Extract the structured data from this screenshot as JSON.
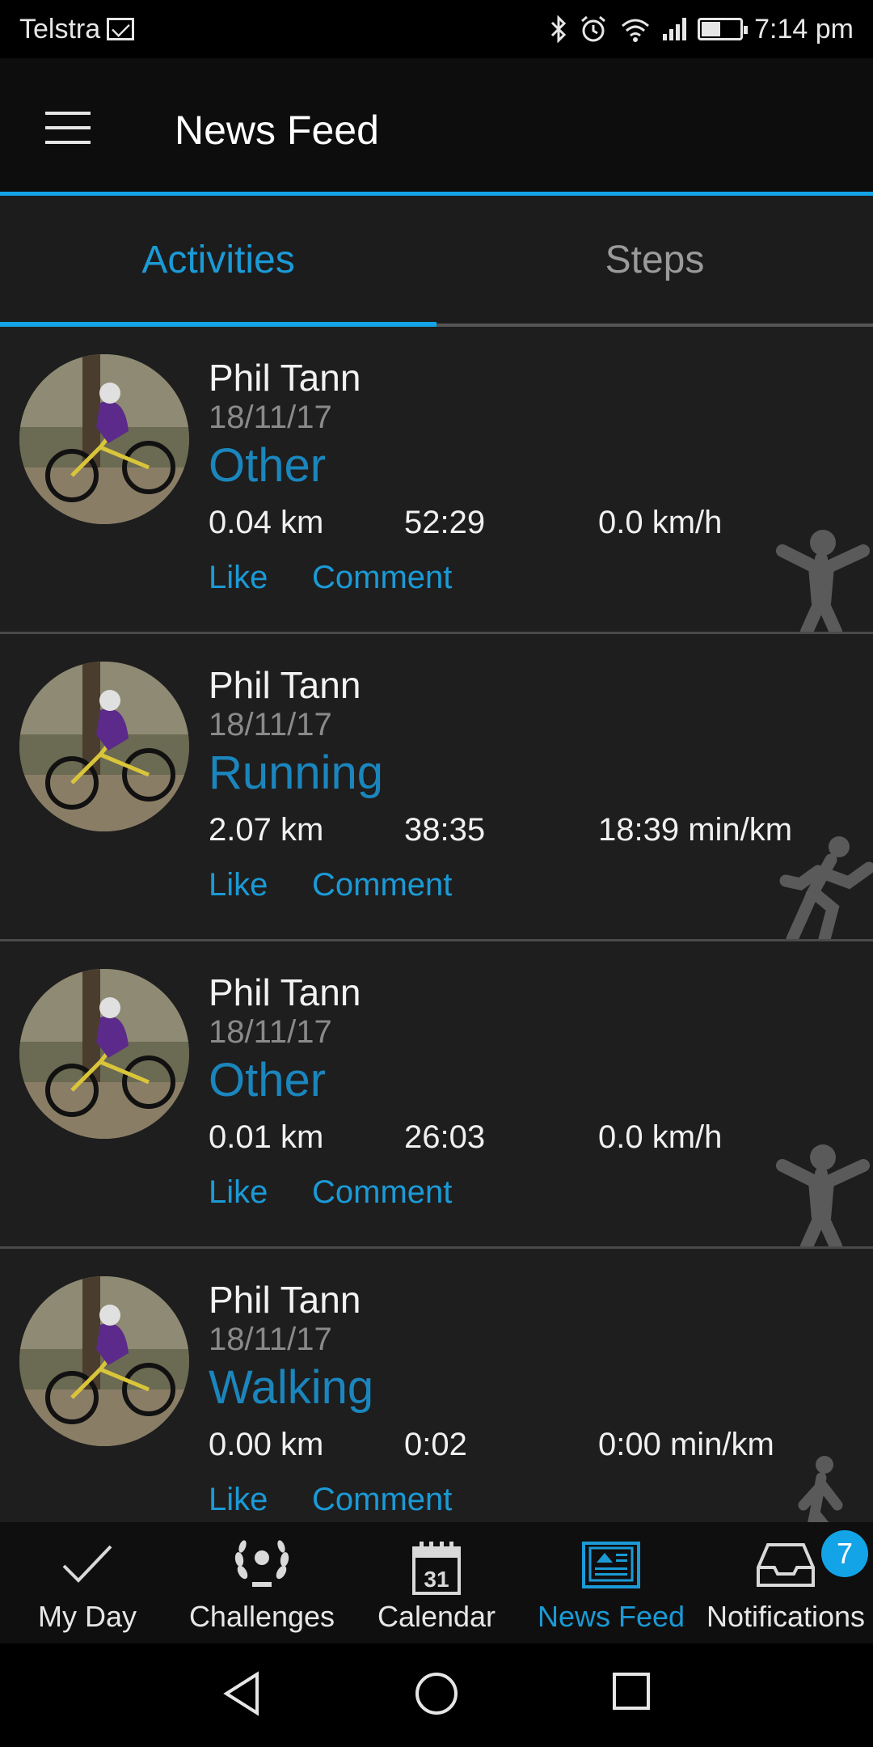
{
  "status_bar": {
    "carrier": "Telstra",
    "time": "7:14 pm",
    "battery_level": 0.5,
    "icons": [
      "mail-icon",
      "bluetooth-icon",
      "alarm-icon",
      "wifi-icon",
      "signal-icon",
      "battery-icon"
    ]
  },
  "app_bar": {
    "title": "News Feed",
    "menu_icon": "hamburger-menu-icon"
  },
  "tabs": [
    {
      "label": "Activities",
      "active": true
    },
    {
      "label": "Steps",
      "active": false
    }
  ],
  "feed": {
    "items": [
      {
        "name": "Phil Tann",
        "date": "18/11/17",
        "type": "Other",
        "distance": "0.04 km",
        "duration": "52:29",
        "pace": "0.0 km/h",
        "like": "Like",
        "comment": "Comment",
        "icon": "other-activity-icon"
      },
      {
        "name": "Phil Tann",
        "date": "18/11/17",
        "type": "Running",
        "distance": "2.07 km",
        "duration": "38:35",
        "pace": "18:39 min/km",
        "like": "Like",
        "comment": "Comment",
        "icon": "running-icon"
      },
      {
        "name": "Phil Tann",
        "date": "18/11/17",
        "type": "Other",
        "distance": "0.01 km",
        "duration": "26:03",
        "pace": "0.0 km/h",
        "like": "Like",
        "comment": "Comment",
        "icon": "other-activity-icon"
      },
      {
        "name": "Phil Tann",
        "date": "18/11/17",
        "type": "Walking",
        "distance": "0.00 km",
        "duration": "0:02",
        "pace": "0:00 min/km",
        "like": "Like",
        "comment": "Comment",
        "icon": "walking-icon"
      }
    ]
  },
  "bottom_nav": {
    "items": [
      {
        "label": "My Day",
        "icon": "checkmark-icon",
        "active": false
      },
      {
        "label": "Challenges",
        "icon": "laurel-icon",
        "active": false
      },
      {
        "label": "Calendar",
        "icon": "calendar-icon",
        "calendar_day": "31",
        "active": false
      },
      {
        "label": "News Feed",
        "icon": "newspaper-icon",
        "active": true
      },
      {
        "label": "Notifications",
        "icon": "inbox-icon",
        "badge": "7",
        "active": false
      }
    ]
  },
  "colors": {
    "accent": "#13a4e8",
    "activity_type": "#1b86bd",
    "background": "#1e1e1e",
    "app_bar": "#0d0d0d"
  }
}
